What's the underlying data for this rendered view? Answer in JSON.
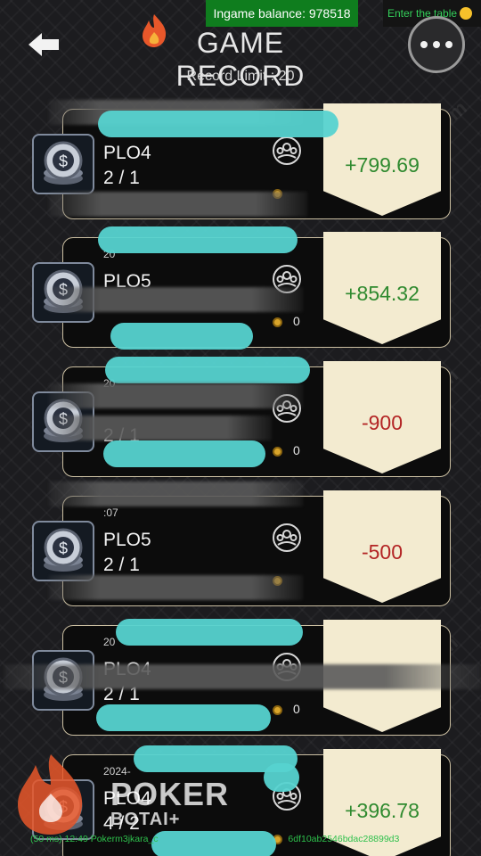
{
  "header": {
    "balance_text": "Ingame balance: 978518",
    "enter_table_text": "Enter the table",
    "title": "GAME RECORD",
    "record_limit": "Record Limit : 20"
  },
  "records": [
    {
      "timestamp": "",
      "game": "PLO4",
      "seats": "2 / 1",
      "coin": "",
      "result": "+799.69",
      "tone": "positive"
    },
    {
      "timestamp": "20",
      "game": "PLO5",
      "seats": "",
      "coin": "0",
      "result": "+854.32",
      "tone": "positive"
    },
    {
      "timestamp": "20",
      "game": "",
      "seats": "2 / 1",
      "coin": "0",
      "result": "-900",
      "tone": "negative"
    },
    {
      "timestamp": ":07",
      "game": "PLO5",
      "seats": "2 / 1",
      "coin": "",
      "result": "-500",
      "tone": "negative"
    },
    {
      "timestamp": "20",
      "game": "PLO4",
      "seats": "2 / 1",
      "coin": "0",
      "result": "",
      "tone": "positive"
    },
    {
      "timestamp": "2024-",
      "game": "PLO4",
      "seats": "4 / 2",
      "coin": "",
      "result": "+396.78",
      "tone": "positive"
    }
  ],
  "logo": {
    "word": "POKER",
    "sub": "BOTAI+"
  },
  "debug_text": "(50 ms) 12:49 Pokerm3jkara_c",
  "debug_text_2": "6df10ab2546bdac28899d3",
  "watermark_text": "PokerBotAI.com",
  "colors": {
    "positive": "#2f8a2f",
    "negative": "#b32424",
    "balance_bg": "#0f7d1e",
    "panel": "#f3ebd0"
  }
}
